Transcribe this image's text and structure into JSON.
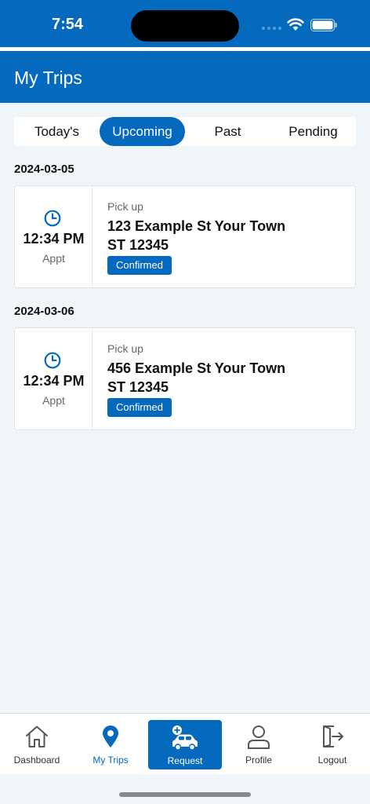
{
  "status_bar": {
    "time": "7:54",
    "icons": [
      "cellular-signal-icon",
      "wifi-icon",
      "battery-icon"
    ]
  },
  "header": {
    "title": "My Trips"
  },
  "tabs": [
    {
      "label": "Today's",
      "active": false
    },
    {
      "label": "Upcoming",
      "active": true
    },
    {
      "label": "Past",
      "active": false
    },
    {
      "label": "Pending",
      "active": false
    }
  ],
  "trips": [
    {
      "date": "2024-03-05",
      "time": "12:34 PM",
      "time_type": "Appt",
      "kind": "Pick up",
      "address_line1": "123 Example St Your Town",
      "address_line2": "ST  12345",
      "status": "Confirmed",
      "icon": "clock-icon"
    },
    {
      "date": "2024-03-06",
      "time": "12:34 PM",
      "time_type": "Appt",
      "kind": "Pick up",
      "address_line1": "456 Example St Your Town",
      "address_line2": "ST  12345",
      "status": "Confirmed",
      "icon": "clock-icon"
    }
  ],
  "bottom_nav": [
    {
      "label": "Dashboard",
      "icon": "home-icon",
      "active": false
    },
    {
      "label": "My Trips",
      "icon": "map-pin-icon",
      "active": true
    },
    {
      "label": "Request",
      "icon": "car-plus-icon",
      "active": false
    },
    {
      "label": "Profile",
      "icon": "person-icon",
      "active": false
    },
    {
      "label": "Logout",
      "icon": "logout-icon",
      "active": false
    }
  ],
  "colors": {
    "brand": "#0569bd",
    "background": "#f0f5fa"
  }
}
